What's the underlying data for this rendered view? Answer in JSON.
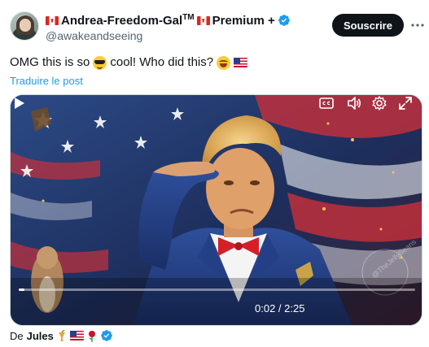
{
  "post": {
    "author": {
      "display_name": "Andrea-Freedom-Gal",
      "tm": "TM",
      "premium_label": "Premium +",
      "handle": "@awakeandseeing"
    },
    "subscribe_label": "Souscrire",
    "text_part1": "OMG this is so",
    "text_part2": "cool! Who did this?",
    "translate_label": "Traduire le post"
  },
  "video": {
    "time_label": "0:02 / 2:25",
    "progress": 0.014,
    "watermark": "@TheJellyBeans"
  },
  "credit": {
    "prefix": "De",
    "name": "Jules"
  },
  "icons": {
    "verified": "verified-badge-icon",
    "more": "more-icon",
    "play": "play-icon",
    "captions": "captions-icon",
    "volume": "volume-icon",
    "settings": "gear-icon",
    "fullscreen": "fullscreen-icon"
  },
  "colors": {
    "accent": "#1d9bf0",
    "button_bg": "#0f1419"
  }
}
